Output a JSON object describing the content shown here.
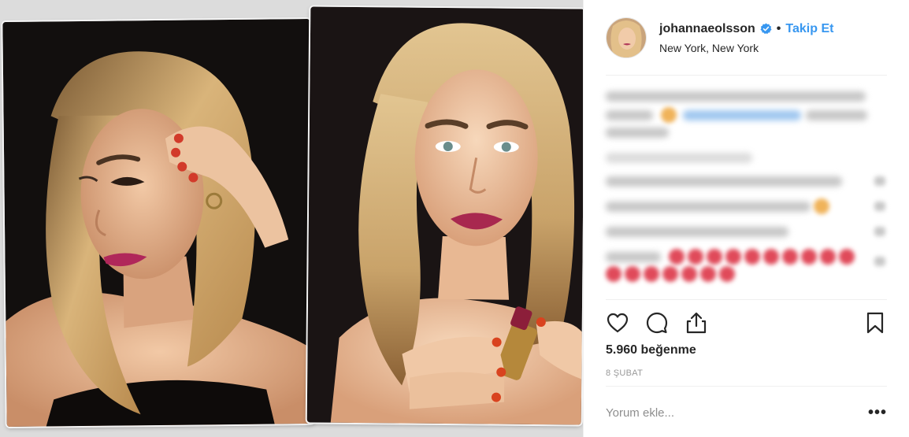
{
  "header": {
    "username": "johannaeolsson",
    "verified_icon": "verified-badge-icon",
    "separator": "•",
    "follow_label": "Takip Et",
    "location": "New York, New York"
  },
  "actions": {
    "like_icon": "heart-icon",
    "comment_icon": "comment-icon",
    "share_icon": "share-icon",
    "save_icon": "bookmark-icon"
  },
  "likes_text": "5.960 beğenme",
  "date_text": "8 ŞUBAT",
  "comment_box": {
    "placeholder": "Yorum ekle...",
    "more_label": "•••"
  },
  "colors": {
    "accent": "#3897f0",
    "text": "#262626",
    "muted": "#999999",
    "divider": "#efefef"
  }
}
